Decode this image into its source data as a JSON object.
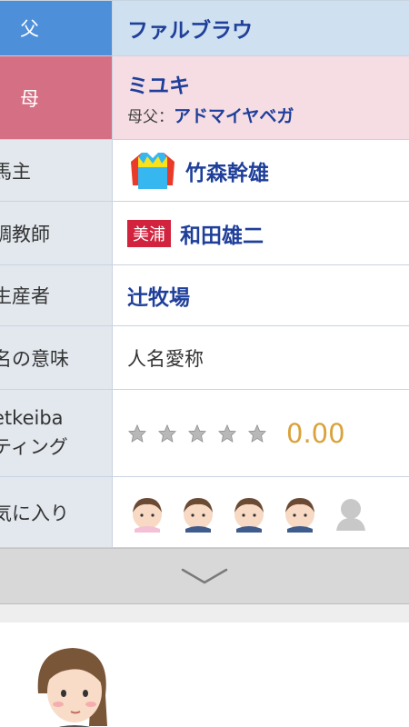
{
  "rows": {
    "father": {
      "label": "父",
      "value": "ファルブラウ"
    },
    "mother": {
      "label": "母",
      "value": "ミユキ",
      "sire_label": "母父：",
      "sire_value": "アドマイヤベガ"
    },
    "owner": {
      "label": "馬主",
      "value": "竹森幹雄",
      "silks_icon": "jockey-silks-icon"
    },
    "trainer": {
      "label": "調教師",
      "region": "美浦",
      "value": "和田雄二"
    },
    "breeder": {
      "label": "生産者",
      "value": "辻牧場"
    },
    "name_meaning": {
      "label": "名の意味",
      "value": "人名愛称"
    },
    "rating": {
      "label_line1": "etkeiba",
      "label_line2": "ティング",
      "stars": 0,
      "max_stars": 5,
      "value": "0.00"
    },
    "favorites": {
      "label": "気に入り",
      "avatars_active": 4,
      "avatars_total": 5
    }
  },
  "expand_icon": "chevron-down-icon",
  "colors": {
    "father_label_bg": "#4d8fd9",
    "mother_label_bg": "#d56f84",
    "link": "#1f3f9a",
    "rating": "#d9a23a",
    "region_badge": "#d1233e"
  }
}
